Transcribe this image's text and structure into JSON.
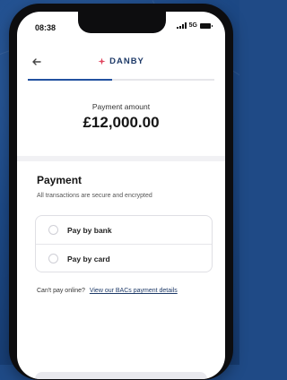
{
  "status_bar": {
    "time": "08:38",
    "network": "5G"
  },
  "header": {
    "brand_name": "DANBY",
    "back_icon": "arrow-left-icon",
    "brand_color": "#1e3a68",
    "accent_color": "#e0455e"
  },
  "progress": {
    "fraction": 0.45
  },
  "summary": {
    "amount_label": "Payment amount",
    "amount_value": "£12,000.00"
  },
  "payment": {
    "title": "Payment",
    "subtitle": "All transactions are secure and encrypted",
    "options": [
      {
        "label": "Pay by bank"
      },
      {
        "label": "Pay by card"
      }
    ]
  },
  "offline": {
    "prompt": "Can't pay online?",
    "link_label": "View our BACs payment details"
  }
}
